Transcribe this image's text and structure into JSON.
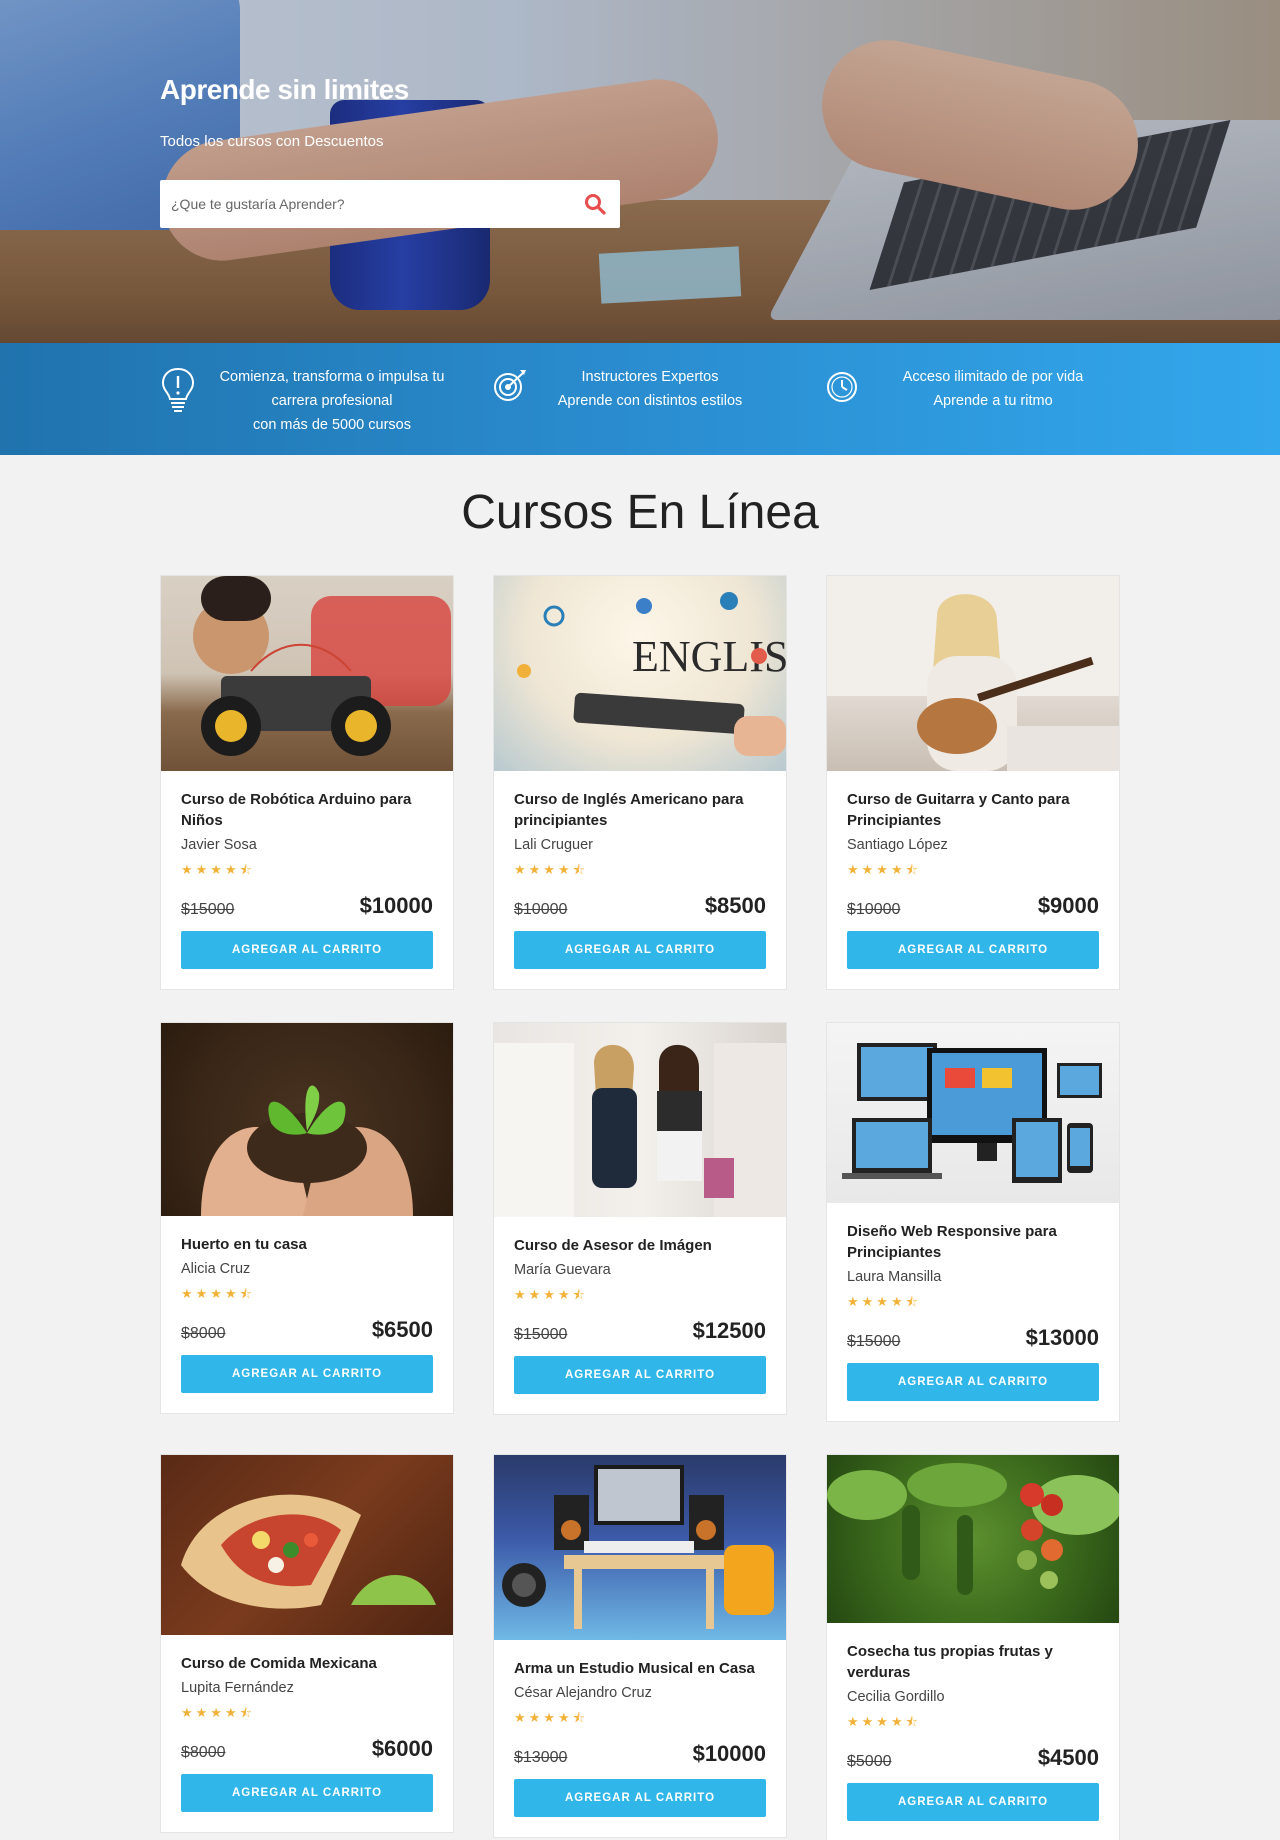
{
  "hero": {
    "title": "Aprende sin limites",
    "subtitle": "Todos los cursos con Descuentos",
    "search_placeholder": "¿Que te gustaría Aprender?"
  },
  "features": [
    {
      "icon": "lightbulb-icon",
      "line1": "Comienza, transforma o impulsa tu",
      "line2": "carrera profesional",
      "line3": "con más de 5000 cursos"
    },
    {
      "icon": "target-icon",
      "line1": "Instructores Expertos",
      "line2": "Aprende con distintos estilos"
    },
    {
      "icon": "clock-icon",
      "line1": "Acceso ilimitado de por vida",
      "line2": "Aprende a tu ritmo"
    }
  ],
  "section_title": "Cursos En Línea",
  "colors": {
    "accent": "#31b6ea",
    "band_start": "#2073ad",
    "band_end": "#33a7ec",
    "stars": "#f2b23a"
  },
  "rating_display": "★★★★⯪",
  "courses": [
    {
      "title": "Curso de Robótica Arduino para Niños",
      "author": "Javier Sosa",
      "old_price": "$15000",
      "price": "$10000",
      "button": "AGREGAR AL CARRITO",
      "rating": 4.5
    },
    {
      "title": "Curso de Inglés Americano para principiantes",
      "author": "Lali Cruguer",
      "old_price": "$10000",
      "price": "$8500",
      "button": "AGREGAR AL CARRITO",
      "rating": 4.5
    },
    {
      "title": "Curso de Guitarra y Canto para Principiantes",
      "author": "Santiago López",
      "old_price": "$10000",
      "price": "$9000",
      "button": "AGREGAR AL CARRITO",
      "rating": 4.5
    },
    {
      "title": "Huerto en tu casa",
      "author": "Alicia Cruz",
      "old_price": "$8000",
      "price": "$6500",
      "button": "AGREGAR AL CARRITO",
      "rating": 4.5
    },
    {
      "title": "Curso de Asesor de Imágen",
      "author": "María Guevara",
      "old_price": "$15000",
      "price": "$12500",
      "button": "AGREGAR AL CARRITO",
      "rating": 4.5
    },
    {
      "title": "Diseño Web Responsive para Principiantes",
      "author": "Laura Mansilla",
      "old_price": "$15000",
      "price": "$13000",
      "button": "AGREGAR AL CARRITO",
      "rating": 4.5
    },
    {
      "title": "Curso de Comida Mexicana",
      "author": "Lupita Fernández",
      "old_price": "$8000",
      "price": "$6000",
      "button": "AGREGAR AL CARRITO",
      "rating": 4.5
    },
    {
      "title": "Arma un Estudio Musical en Casa",
      "author": "César Alejandro Cruz",
      "old_price": "$13000",
      "price": "$10000",
      "button": "AGREGAR AL CARRITO",
      "rating": 4.5
    },
    {
      "title": "Cosecha tus propias frutas y verduras",
      "author": "Cecilia Gordillo",
      "old_price": "$5000",
      "price": "$4500",
      "button": "AGREGAR AL CARRITO",
      "rating": 4.5
    }
  ]
}
